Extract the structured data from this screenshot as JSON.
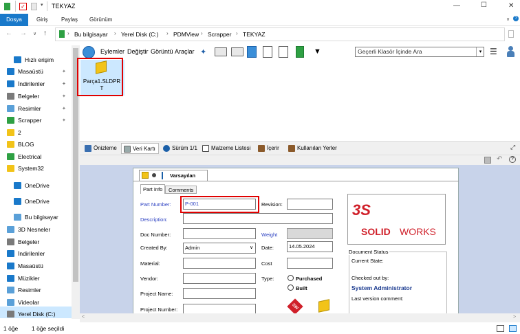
{
  "window": {
    "title": "TEKYAZ",
    "minimize_glyph": "—",
    "maximize_glyph": "☐",
    "close_glyph": "✕"
  },
  "ribbon": {
    "tabs": [
      "Dosya",
      "Giriş",
      "Paylaş",
      "Görünüm"
    ],
    "active_tab": "Dosya"
  },
  "nav": {
    "back": "←",
    "forward": "→",
    "up": "↑",
    "dropdown": "∨"
  },
  "address": {
    "crumbs": [
      "Bu bilgisayar",
      "Yerel Disk (C:)",
      "PDMView",
      "Scrapper",
      "TEKYAZ"
    ],
    "separator": "›"
  },
  "sidebar": {
    "items": [
      {
        "label": "Hızlı erişim",
        "icon": "star-icon",
        "pinned": false
      },
      {
        "label": "Masaüstü",
        "icon": "desktop-icon",
        "pinned": true
      },
      {
        "label": "İndirilenler",
        "icon": "download-icon",
        "pinned": true
      },
      {
        "label": "Belgeler",
        "icon": "documents-icon",
        "pinned": true
      },
      {
        "label": "Resimler",
        "icon": "pictures-icon",
        "pinned": true
      },
      {
        "label": "Scrapper",
        "icon": "pdm-folder-icon",
        "pinned": true
      },
      {
        "label": "2",
        "icon": "folder-icon",
        "pinned": false
      },
      {
        "label": "BLOG",
        "icon": "folder-icon",
        "pinned": false
      },
      {
        "label": "Electrical",
        "icon": "pdm-folder-icon",
        "pinned": false
      },
      {
        "label": "System32",
        "icon": "folder-icon",
        "pinned": false
      },
      {
        "label": "OneDrive",
        "icon": "cloud-icon",
        "pinned": false
      },
      {
        "label": "OneDrive",
        "icon": "cloud-icon",
        "pinned": false
      },
      {
        "label": "Bu bilgisayar",
        "icon": "computer-icon",
        "pinned": false
      },
      {
        "label": "3D Nesneler",
        "icon": "3d-objects-icon",
        "pinned": false
      },
      {
        "label": "Belgeler",
        "icon": "documents-icon",
        "pinned": false
      },
      {
        "label": "İndirilenler",
        "icon": "download-icon",
        "pinned": false
      },
      {
        "label": "Masaüstü",
        "icon": "desktop-icon",
        "pinned": false
      },
      {
        "label": "Müzikler",
        "icon": "music-icon",
        "pinned": false
      },
      {
        "label": "Resimler",
        "icon": "pictures-icon",
        "pinned": false
      },
      {
        "label": "Videolar",
        "icon": "videos-icon",
        "pinned": false
      },
      {
        "label": "Yerel Disk (C:)",
        "icon": "drive-icon",
        "pinned": false,
        "selected": true
      }
    ]
  },
  "toolbar": {
    "menus": [
      "Eylemler",
      "Değiştir",
      "Görüntü",
      "Araçlar"
    ],
    "search_placeholder": "Geçerli Klasör İçinde Ara"
  },
  "files": [
    {
      "name": "Parça1.SLDPRT",
      "name_line1": "Parça1.SLDPR",
      "name_line2": "T",
      "icon": "solidworks-part-icon"
    }
  ],
  "panel_tabs": [
    {
      "label": "Önizleme",
      "icon": "preview-icon"
    },
    {
      "label": "Veri Kartı",
      "icon": "datacard-icon",
      "active": true
    },
    {
      "label": "Sürüm 1/1",
      "icon": "version-icon"
    },
    {
      "label": "Malzeme Listesi",
      "icon": "bom-icon"
    },
    {
      "label": "İçerir",
      "icon": "contains-icon"
    },
    {
      "label": "Kullanılan Yerler",
      "icon": "where-used-icon"
    }
  ],
  "card": {
    "config_label": "Varsayılan",
    "tabs": [
      "Part Info",
      "Comments"
    ],
    "fields": {
      "part_number_label": "Part Number:",
      "part_number_value": "P-001",
      "revision_label": "Revision:",
      "description_label": "Description:",
      "doc_number_label": "Doc Number:",
      "weight_label": "Weight",
      "created_by_label": "Created By:",
      "created_by_value": "Admin",
      "date_label": "Date:",
      "date_value": "14.05.2024",
      "material_label": "Material:",
      "cost_label": "Cost",
      "vendor_label": "Vendor:",
      "type_label": "Type:",
      "type_options": [
        "Purchased",
        "Built"
      ],
      "project_name_label": "Project Name:",
      "project_number_label": "Project Number:"
    },
    "logo": {
      "ds": "3S",
      "text_solid": "SOLID",
      "text_works": "WORKS"
    },
    "status": {
      "title": "Document Status",
      "current_state_label": "Current State:",
      "checked_out_label": "Checked out by:",
      "checked_out_value": "System Administrator",
      "last_comment_label": "Last version comment:"
    }
  },
  "statusbar": {
    "count": "1 öğe",
    "selected": "1 öğe seçildi"
  },
  "colors": {
    "accent": "#1979ca",
    "highlight": "#e00000",
    "selection": "#cce8ff",
    "solidworks_red": "#d0202a"
  }
}
